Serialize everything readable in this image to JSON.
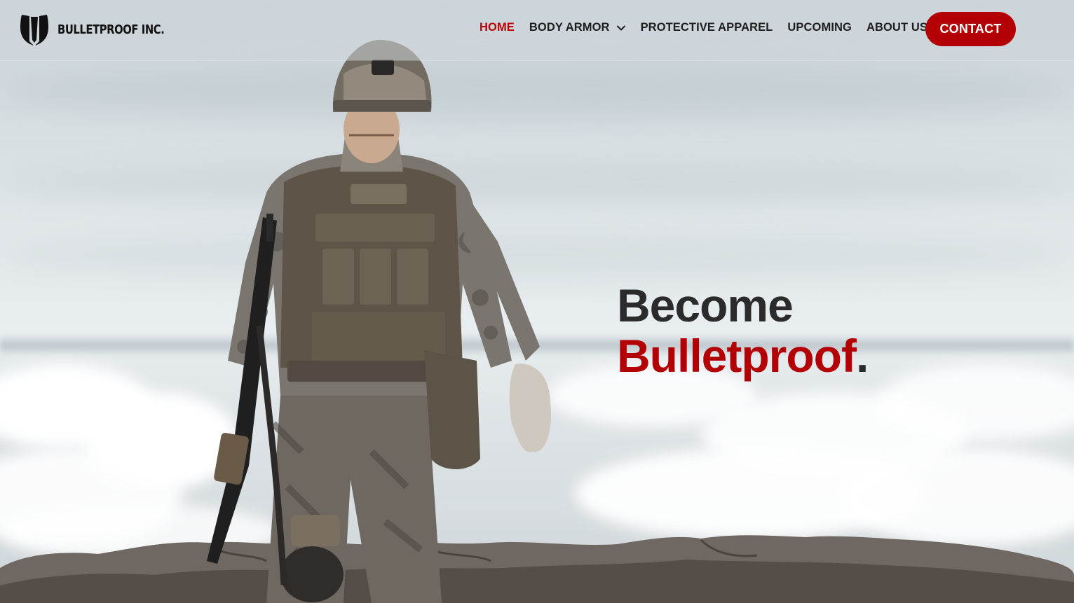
{
  "brand": {
    "logo_text": "BULLETPROOF INC.",
    "logo_icon": "shield-logo-icon"
  },
  "nav": {
    "items": [
      {
        "label": "HOME",
        "active": true
      },
      {
        "label": "BODY ARMOR",
        "has_dropdown": true,
        "dropdown_icon": "chevron-down-icon"
      },
      {
        "label": "PROTECTIVE APPAREL"
      },
      {
        "label": "UPCOMING"
      },
      {
        "label": "ABOUT US"
      }
    ],
    "contact_label": "CONTACT"
  },
  "hero": {
    "line1": "Become",
    "line2_accent": "Bulletproof",
    "line2_end": "."
  },
  "colors": {
    "accent": "#b30005",
    "text_dark": "#2b2b2b",
    "nav_text": "#1e1e1e"
  }
}
